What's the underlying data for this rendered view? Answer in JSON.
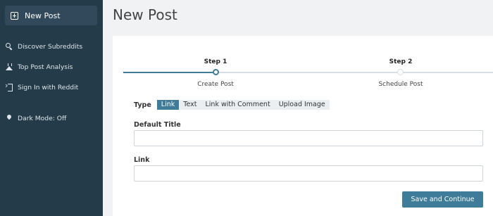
{
  "sidebar": {
    "new_post_label": "New Post",
    "items": [
      {
        "label": "Discover Subreddits",
        "icon": "search-icon"
      },
      {
        "label": "Top Post Analysis",
        "icon": "flask-icon"
      },
      {
        "label": "Sign In with Reddit",
        "icon": "sign-in-icon"
      },
      {
        "label": "Dark Mode: Off",
        "icon": "map-pin-icon"
      }
    ]
  },
  "main": {
    "title": "New Post",
    "steps": [
      {
        "label": "Step 1",
        "sub": "Create Post",
        "active": true
      },
      {
        "label": "Step 2",
        "sub": "Schedule Post",
        "active": false
      }
    ],
    "type_label": "Type",
    "type_tabs": [
      "Link",
      "Text",
      "Link with Comment",
      "Upload Image"
    ],
    "selected_type": "Link",
    "default_title_label": "Default Title",
    "default_title_value": "",
    "link_label": "Link",
    "link_value": "",
    "save_label": "Save and Continue"
  },
  "colors": {
    "sidebar_bg": "#243b49",
    "accent": "#3e7c99"
  }
}
